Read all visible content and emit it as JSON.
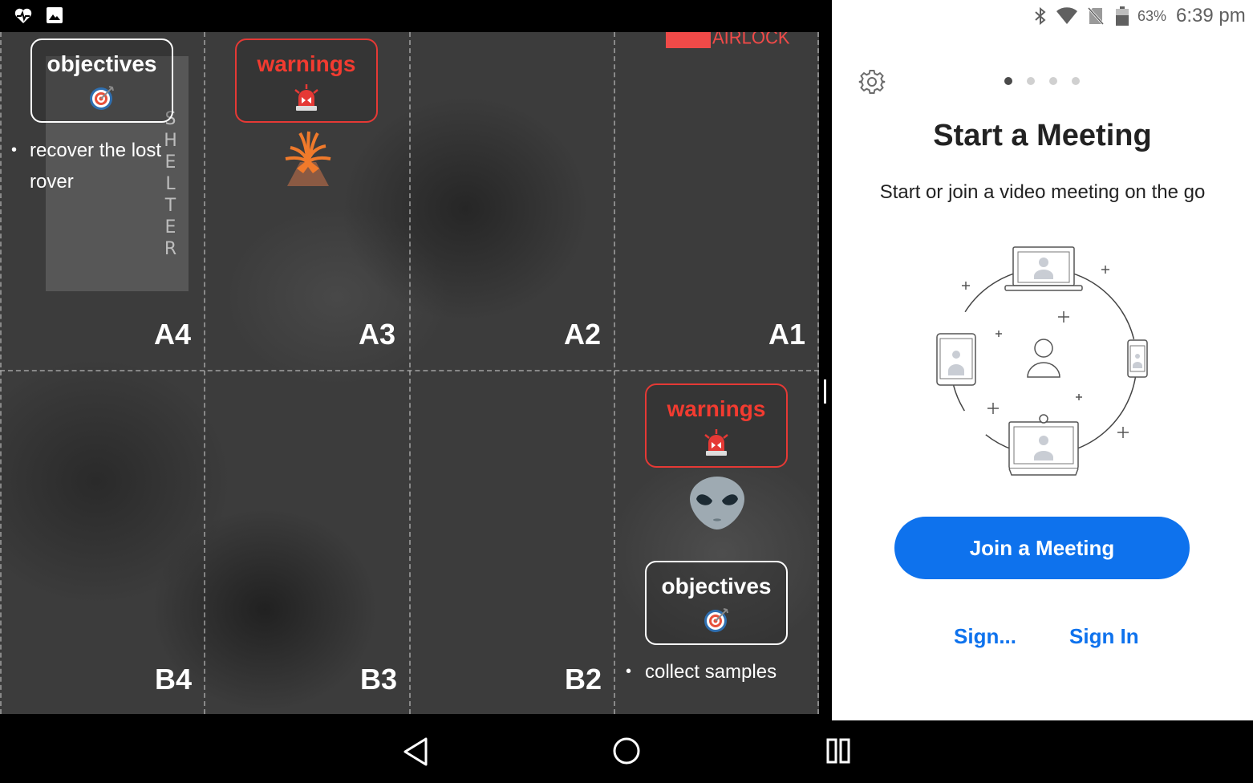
{
  "status_bar": {
    "left_icons": [
      "heart-pulse-icon",
      "image-icon"
    ],
    "right_icons": [
      "bluetooth-icon",
      "wifi-icon",
      "no-sim-icon",
      "battery-icon"
    ],
    "battery": "63%",
    "time": "6:39 pm"
  },
  "map": {
    "cells": {
      "a4": "A4",
      "a3": "A3",
      "a2": "A2",
      "a1": "A1",
      "b4": "B4",
      "b3": "B3",
      "b2": "B2"
    },
    "shelter_label": "SHELTER",
    "airlock_label": "AIRLOCK",
    "a4_objectives": {
      "title": "objectives",
      "icon": "target-icon",
      "bullet": "recover the lost rover"
    },
    "a3_warnings": {
      "title": "warnings",
      "icon": "siren-icon",
      "hazard_icon": "volcano-icon"
    },
    "b1_warnings": {
      "title": "warnings",
      "icon": "siren-icon",
      "hazard_icon": "alien-icon"
    },
    "b1_objectives": {
      "title": "objectives",
      "icon": "target-icon",
      "bullet": "collect samples"
    },
    "colors": {
      "warning": "#f23b30",
      "objective": "#ffffff"
    }
  },
  "zoom": {
    "title": "Start a Meeting",
    "subtitle": "Start or join a video meeting on the go",
    "carousel_pages": 4,
    "carousel_active": 1,
    "join_button": "Join a Meeting",
    "sign_up_link": "Sign...",
    "sign_in_link": "Sign In",
    "colors": {
      "accent": "#0e72ed"
    }
  },
  "nav_bar": {
    "icons": [
      "back-icon",
      "home-icon",
      "recents-icon"
    ]
  }
}
